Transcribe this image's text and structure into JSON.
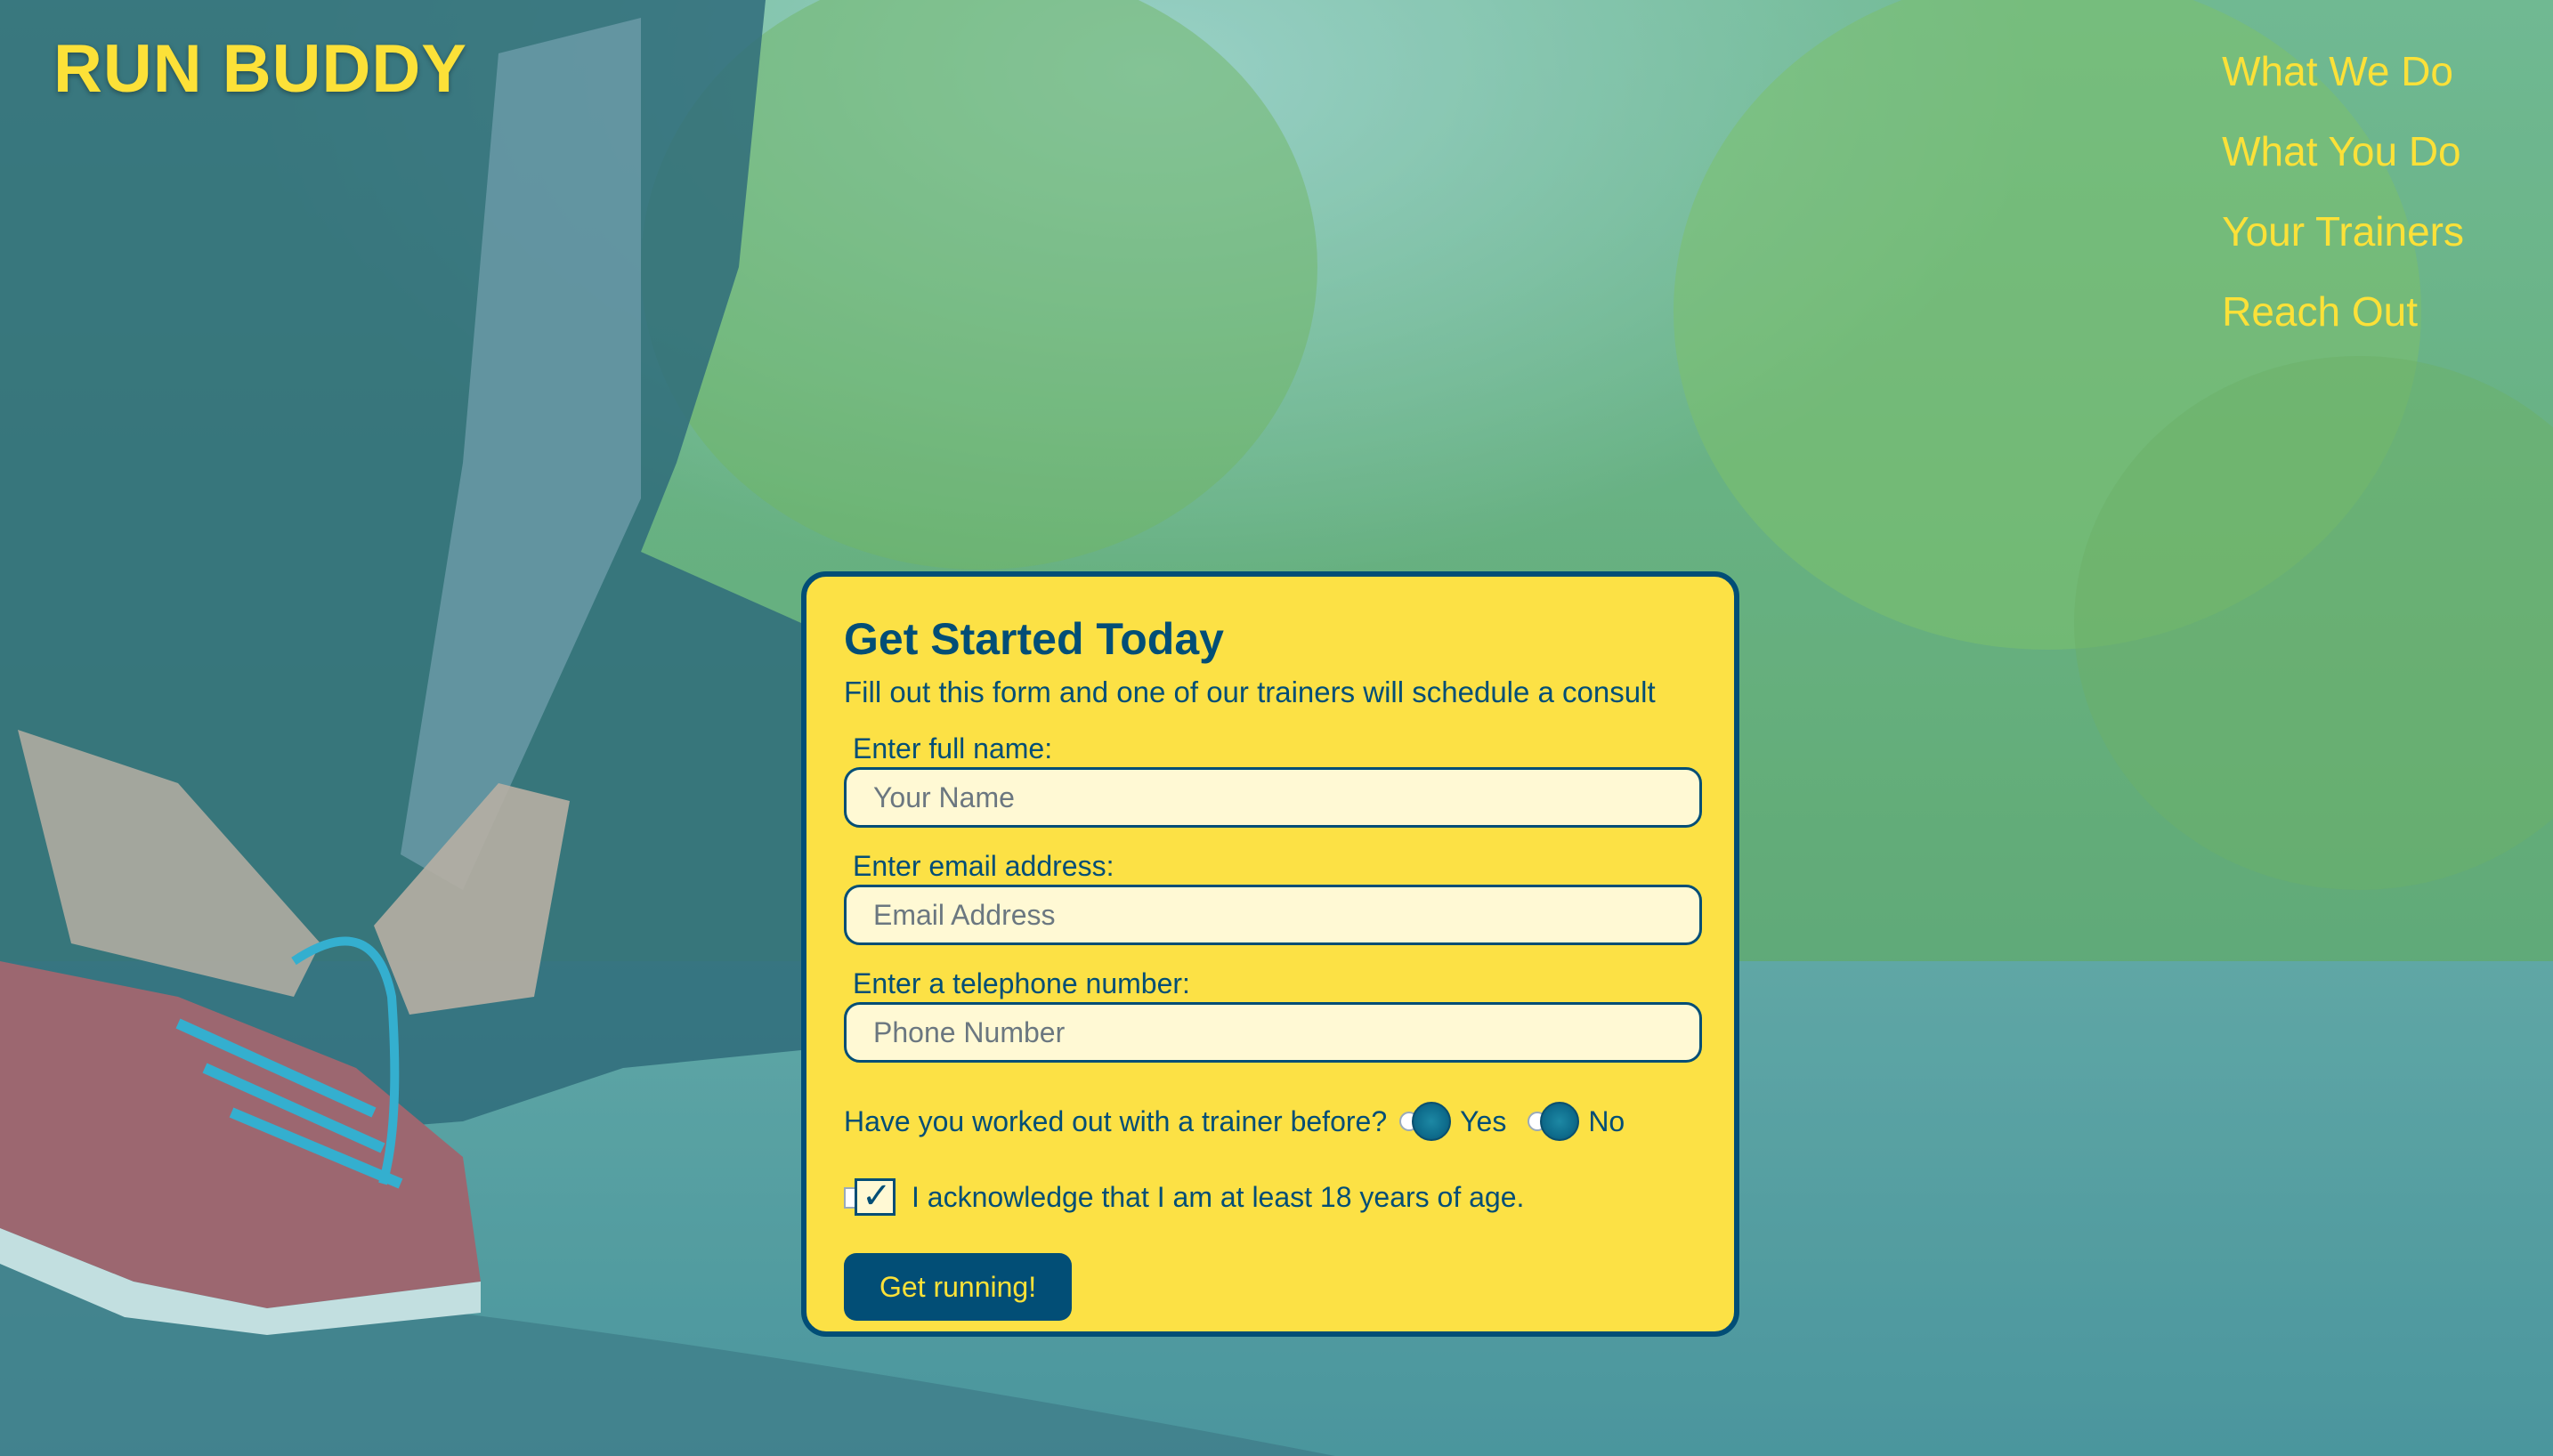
{
  "header": {
    "logo": "RUN BUDDY",
    "nav": [
      {
        "label": "What We Do"
      },
      {
        "label": "What You Do"
      },
      {
        "label": "Your Trainers"
      },
      {
        "label": "Reach Out"
      }
    ]
  },
  "form": {
    "title": "Get Started Today",
    "subtitle": "Fill out this form and one of our trainers will schedule a consult",
    "name_label": "Enter full name:",
    "name_placeholder": "Your Name",
    "name_value": "",
    "email_label": "Enter email address:",
    "email_placeholder": "Email Address",
    "email_value": "",
    "phone_label": "Enter a telephone number:",
    "phone_placeholder": "Phone Number",
    "phone_value": "",
    "trainer_question": "Have you worked out with a trainer before?",
    "option_yes": "Yes",
    "option_no": "No",
    "age_ack": "I acknowledge that I am at least 18 years of age.",
    "age_ack_checked": true,
    "submit_label": "Get running!"
  },
  "colors": {
    "accent_yellow": "#fce138",
    "primary_blue": "#024e76",
    "input_bg": "#fff9d4",
    "overlay_teal": "#39a6b2"
  }
}
